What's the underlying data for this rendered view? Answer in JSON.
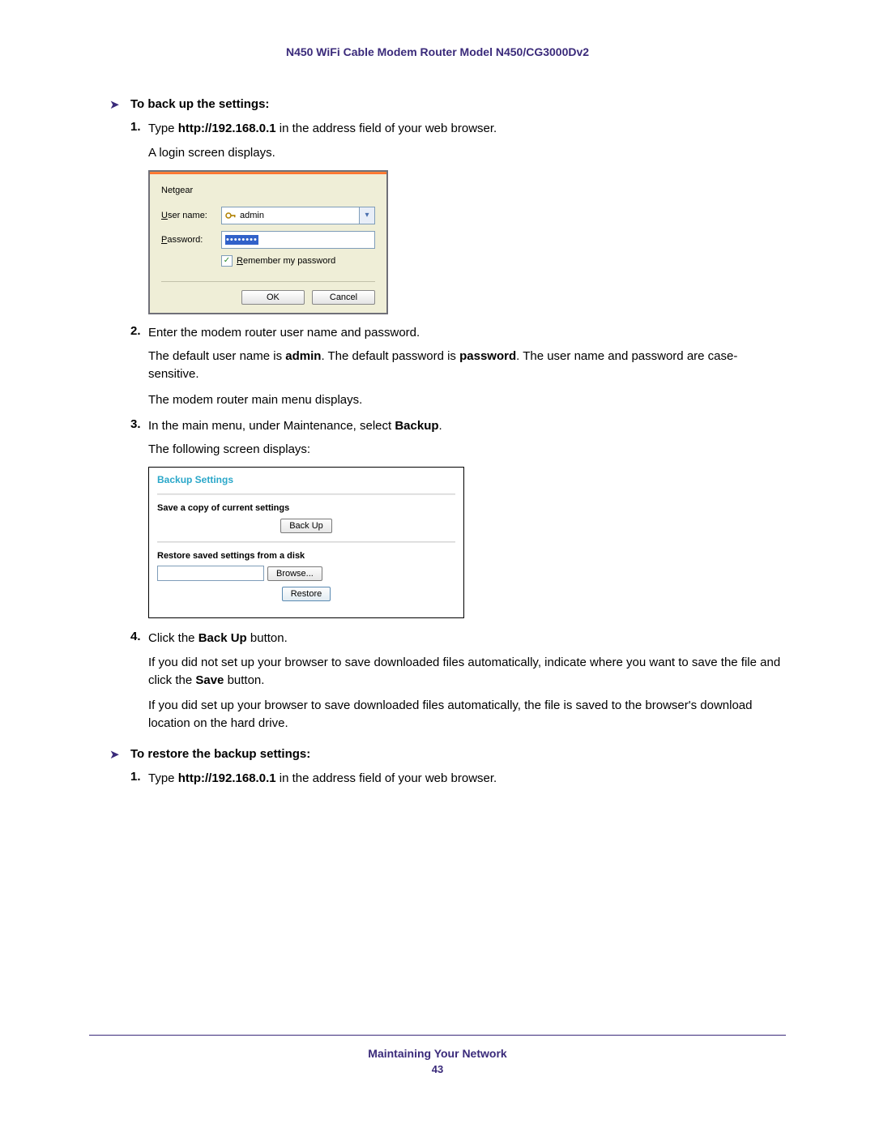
{
  "header": {
    "title": "N450 WiFi Cable Modem Router Model N450/CG3000Dv2"
  },
  "section1": {
    "bullet": "To back up the settings:",
    "step1_num": "1.",
    "step1_a": "Type ",
    "step1_b": "http://192.168.0.1",
    "step1_c": " in the address field of your web browser.",
    "step1_line2": "A login screen displays.",
    "step2_num": "2.",
    "step2": "Enter the modem router user name and password.",
    "step2_para_a": "The default user name is ",
    "step2_para_b": "admin",
    "step2_para_c": ". The default password is ",
    "step2_para_d": "password",
    "step2_para_e": ". The user name and password are case-sensitive.",
    "step2_para2": "The modem router main menu displays.",
    "step3_num": "3.",
    "step3_a": "In the main menu, under Maintenance, select ",
    "step3_b": "Backup",
    "step3_c": ".",
    "step3_line2": "The following screen displays:",
    "step4_num": "4.",
    "step4_a": "Click the ",
    "step4_b": "Back Up",
    "step4_c": " button.",
    "step4_para1_a": "If you did not set up your browser to save downloaded files automatically, indicate where you want to save the file and click the ",
    "step4_para1_b": "Save",
    "step4_para1_c": " button.",
    "step4_para2": "If you did set up your browser to save downloaded files automatically, the file is saved to the browser's download location on the hard drive."
  },
  "section2": {
    "bullet": "To restore the backup settings:",
    "step1_num": "1.",
    "step1_a": "Type ",
    "step1_b": "http://192.168.0.1",
    "step1_c": " in the address field of your web browser."
  },
  "login": {
    "site": "Netgear",
    "user_label": "User name:",
    "pwd_label": "Password:",
    "user_value": "admin",
    "pwd_masked": "••••••••",
    "remember": "Remember my password",
    "ok": "OK",
    "cancel": "Cancel"
  },
  "backup": {
    "title": "Backup Settings",
    "save_label": "Save a copy of current settings",
    "backup_btn": "Back Up",
    "restore_label": "Restore saved settings from a disk",
    "browse_btn": "Browse...",
    "restore_btn": "Restore"
  },
  "footer": {
    "title": "Maintaining Your Network",
    "page": "43"
  }
}
